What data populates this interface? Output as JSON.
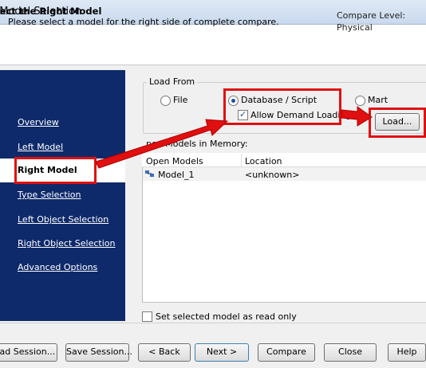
{
  "window": {
    "title": "t Model Selection"
  },
  "header": {
    "title": "elect the Right Model",
    "description": "Please select a model for the right side of complete compare.",
    "compare_level_label": "Compare Level:",
    "compare_level_value": "Physical"
  },
  "nav": {
    "items": [
      {
        "label": "Overview"
      },
      {
        "label": "Left Model"
      },
      {
        "label": "Right Model"
      },
      {
        "label": "Type Selection"
      },
      {
        "label": "Left Object Selection"
      },
      {
        "label": "Right Object Selection"
      },
      {
        "label": "Advanced Options"
      }
    ]
  },
  "load_from": {
    "label": "Load From",
    "option_file": "File",
    "option_db": "Database / Script",
    "option_mart": "Mart",
    "selected": "Database / Script",
    "allow_demand_loading": "Allow Demand Loading",
    "allow_demand_loading_checked": true,
    "load_button": "Load..."
  },
  "models": {
    "label": "pen Models in Memory:",
    "columns": [
      "Open Models",
      "Location"
    ],
    "rows": [
      {
        "name": "Model_1",
        "location": "<unknown>"
      }
    ]
  },
  "read_only": {
    "label": "Set selected model as read only",
    "checked": false
  },
  "footer": {
    "load_session": "oad Session...",
    "save_session": "Save Session...",
    "back": "< Back",
    "next": "Next >",
    "compare": "Compare",
    "close": "Close",
    "help": "Help"
  },
  "colors": {
    "sidebar": "#0f2a6b",
    "highlight": "#e01010"
  }
}
